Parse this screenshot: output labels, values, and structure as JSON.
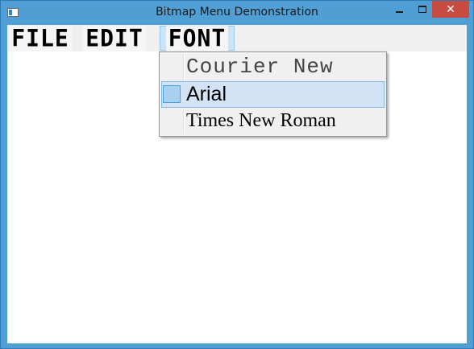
{
  "window": {
    "title": "Bitmap Menu Demonstration",
    "close_glyph": "✕"
  },
  "menubar": {
    "items": [
      {
        "label": "FILE"
      },
      {
        "label": "EDIT"
      },
      {
        "label": "FONT",
        "state": "open"
      }
    ]
  },
  "font_menu": {
    "items": [
      {
        "label": "Courier New",
        "checked": false
      },
      {
        "label": "Arial",
        "checked": true,
        "highlighted": true
      },
      {
        "label": "Times New Roman",
        "checked": false
      }
    ]
  },
  "colors": {
    "title_bar": "#4f9fd4",
    "close_button": "#c74b41",
    "menu_highlight": "#cce4f7",
    "item_highlight": "#d1e3f4",
    "check_fill": "#a8d0ef"
  }
}
